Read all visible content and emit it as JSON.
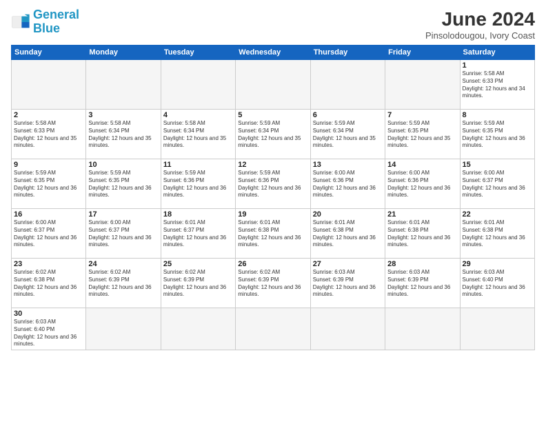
{
  "logo": {
    "line1": "General",
    "line2": "Blue"
  },
  "title": "June 2024",
  "subtitle": "Pinsolodougou, Ivory Coast",
  "weekdays": [
    "Sunday",
    "Monday",
    "Tuesday",
    "Wednesday",
    "Thursday",
    "Friday",
    "Saturday"
  ],
  "weeks": [
    [
      {
        "day": "",
        "empty": true
      },
      {
        "day": "",
        "empty": true
      },
      {
        "day": "",
        "empty": true
      },
      {
        "day": "",
        "empty": true
      },
      {
        "day": "",
        "empty": true
      },
      {
        "day": "",
        "empty": true
      },
      {
        "day": "1",
        "sunrise": "5:58 AM",
        "sunset": "6:33 PM",
        "daylight": "12 hours and 34 minutes."
      }
    ],
    [
      {
        "day": "2",
        "sunrise": "5:58 AM",
        "sunset": "6:33 PM",
        "daylight": "12 hours and 35 minutes."
      },
      {
        "day": "3",
        "sunrise": "5:58 AM",
        "sunset": "6:34 PM",
        "daylight": "12 hours and 35 minutes."
      },
      {
        "day": "4",
        "sunrise": "5:58 AM",
        "sunset": "6:34 PM",
        "daylight": "12 hours and 35 minutes."
      },
      {
        "day": "5",
        "sunrise": "5:59 AM",
        "sunset": "6:34 PM",
        "daylight": "12 hours and 35 minutes."
      },
      {
        "day": "6",
        "sunrise": "5:59 AM",
        "sunset": "6:34 PM",
        "daylight": "12 hours and 35 minutes."
      },
      {
        "day": "7",
        "sunrise": "5:59 AM",
        "sunset": "6:35 PM",
        "daylight": "12 hours and 35 minutes."
      },
      {
        "day": "8",
        "sunrise": "5:59 AM",
        "sunset": "6:35 PM",
        "daylight": "12 hours and 36 minutes."
      }
    ],
    [
      {
        "day": "9",
        "sunrise": "5:59 AM",
        "sunset": "6:35 PM",
        "daylight": "12 hours and 36 minutes."
      },
      {
        "day": "10",
        "sunrise": "5:59 AM",
        "sunset": "6:35 PM",
        "daylight": "12 hours and 36 minutes."
      },
      {
        "day": "11",
        "sunrise": "5:59 AM",
        "sunset": "6:36 PM",
        "daylight": "12 hours and 36 minutes."
      },
      {
        "day": "12",
        "sunrise": "5:59 AM",
        "sunset": "6:36 PM",
        "daylight": "12 hours and 36 minutes."
      },
      {
        "day": "13",
        "sunrise": "6:00 AM",
        "sunset": "6:36 PM",
        "daylight": "12 hours and 36 minutes."
      },
      {
        "day": "14",
        "sunrise": "6:00 AM",
        "sunset": "6:36 PM",
        "daylight": "12 hours and 36 minutes."
      },
      {
        "day": "15",
        "sunrise": "6:00 AM",
        "sunset": "6:37 PM",
        "daylight": "12 hours and 36 minutes."
      }
    ],
    [
      {
        "day": "16",
        "sunrise": "6:00 AM",
        "sunset": "6:37 PM",
        "daylight": "12 hours and 36 minutes."
      },
      {
        "day": "17",
        "sunrise": "6:00 AM",
        "sunset": "6:37 PM",
        "daylight": "12 hours and 36 minutes."
      },
      {
        "day": "18",
        "sunrise": "6:01 AM",
        "sunset": "6:37 PM",
        "daylight": "12 hours and 36 minutes."
      },
      {
        "day": "19",
        "sunrise": "6:01 AM",
        "sunset": "6:38 PM",
        "daylight": "12 hours and 36 minutes."
      },
      {
        "day": "20",
        "sunrise": "6:01 AM",
        "sunset": "6:38 PM",
        "daylight": "12 hours and 36 minutes."
      },
      {
        "day": "21",
        "sunrise": "6:01 AM",
        "sunset": "6:38 PM",
        "daylight": "12 hours and 36 minutes."
      },
      {
        "day": "22",
        "sunrise": "6:01 AM",
        "sunset": "6:38 PM",
        "daylight": "12 hours and 36 minutes."
      }
    ],
    [
      {
        "day": "23",
        "sunrise": "6:02 AM",
        "sunset": "6:38 PM",
        "daylight": "12 hours and 36 minutes."
      },
      {
        "day": "24",
        "sunrise": "6:02 AM",
        "sunset": "6:39 PM",
        "daylight": "12 hours and 36 minutes."
      },
      {
        "day": "25",
        "sunrise": "6:02 AM",
        "sunset": "6:39 PM",
        "daylight": "12 hours and 36 minutes."
      },
      {
        "day": "26",
        "sunrise": "6:02 AM",
        "sunset": "6:39 PM",
        "daylight": "12 hours and 36 minutes."
      },
      {
        "day": "27",
        "sunrise": "6:03 AM",
        "sunset": "6:39 PM",
        "daylight": "12 hours and 36 minutes."
      },
      {
        "day": "28",
        "sunrise": "6:03 AM",
        "sunset": "6:39 PM",
        "daylight": "12 hours and 36 minutes."
      },
      {
        "day": "29",
        "sunrise": "6:03 AM",
        "sunset": "6:40 PM",
        "daylight": "12 hours and 36 minutes."
      }
    ],
    [
      {
        "day": "30",
        "sunrise": "6:03 AM",
        "sunset": "6:40 PM",
        "daylight": "12 hours and 36 minutes."
      },
      {
        "day": "",
        "empty": true
      },
      {
        "day": "",
        "empty": true
      },
      {
        "day": "",
        "empty": true
      },
      {
        "day": "",
        "empty": true
      },
      {
        "day": "",
        "empty": true
      },
      {
        "day": "",
        "empty": true
      }
    ]
  ]
}
